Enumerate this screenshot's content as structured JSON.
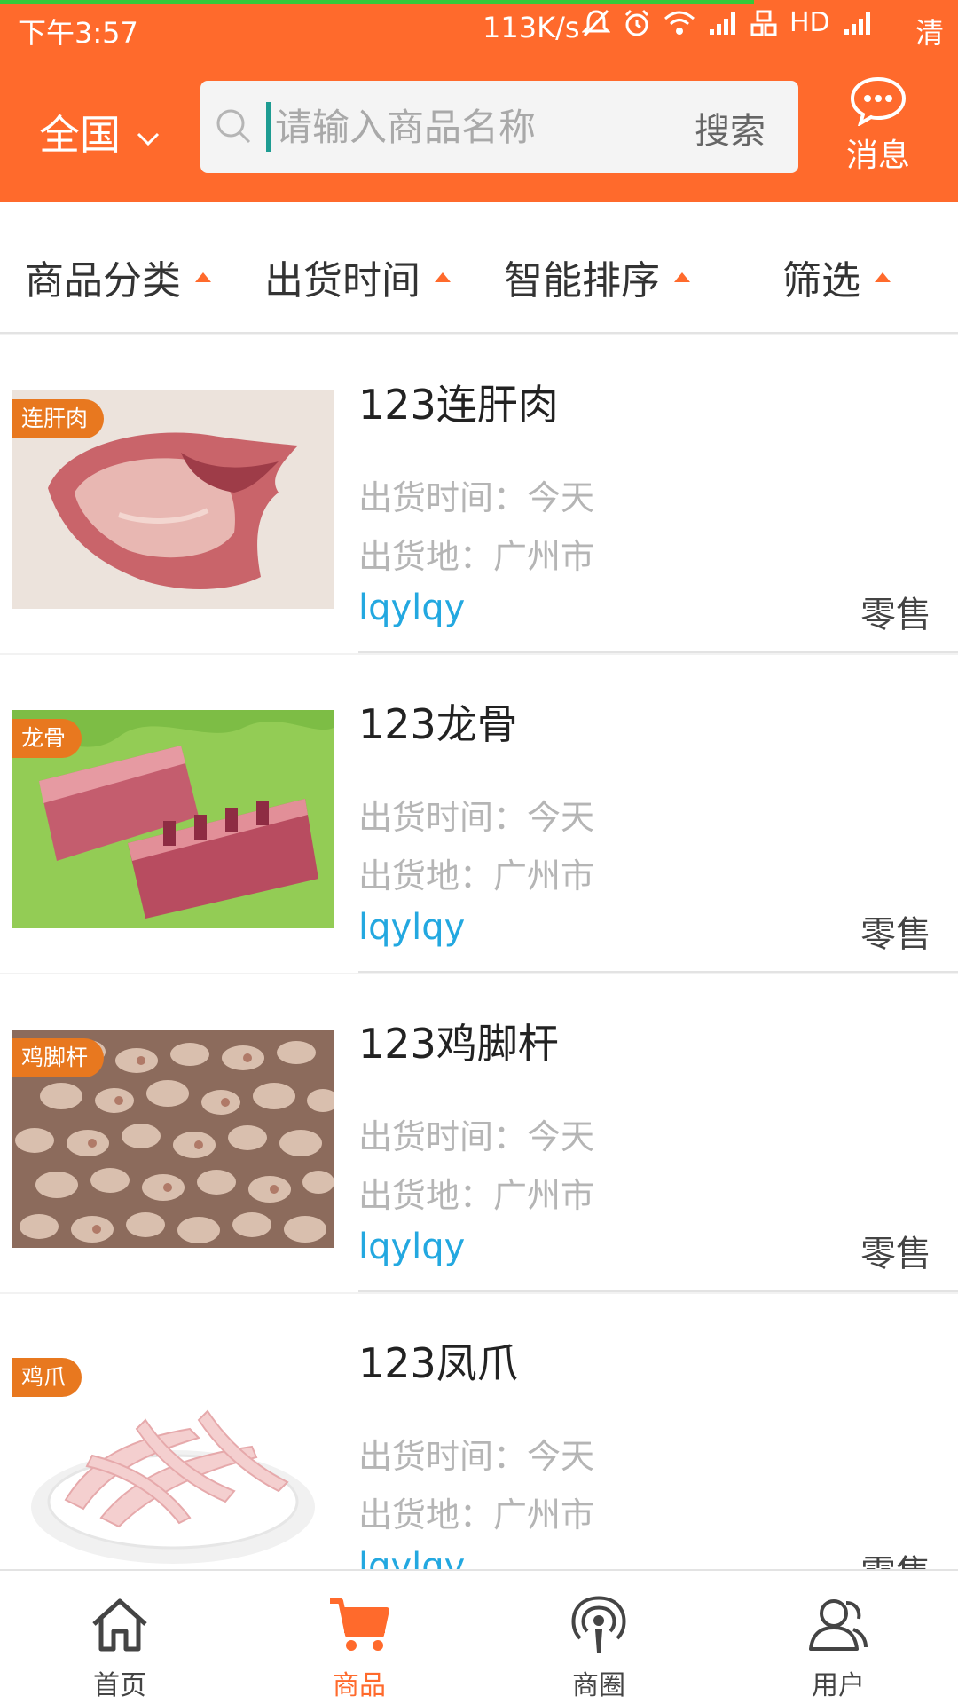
{
  "status_bar": {
    "time": "下午3:57",
    "network_speed": "113K/s",
    "hd_label": "HD",
    "right_label": "清"
  },
  "header": {
    "region_label": "全国",
    "search_placeholder": "请输入商品名称",
    "search_button": "搜索",
    "message_label": "消息",
    "accent_color": "#ff6a2c"
  },
  "filters": [
    {
      "label": "商品分类"
    },
    {
      "label": "出货时间"
    },
    {
      "label": "智能排序"
    },
    {
      "label": "筛选"
    }
  ],
  "products": [
    {
      "tag": "连肝肉",
      "name": "123连肝肉",
      "ship_time": "出货时间：今天",
      "ship_place": "出货地：广州市",
      "seller": "lqylqy",
      "type": "零售",
      "image": "meat-slab"
    },
    {
      "tag": "龙骨",
      "name": "123龙骨",
      "ship_time": "出货时间：今天",
      "ship_place": "出货地：广州市",
      "seller": "lqylqy",
      "type": "零售",
      "image": "ribs-on-lettuce"
    },
    {
      "tag": "鸡脚杆",
      "name": "123鸡脚杆",
      "ship_time": "出货时间：今天",
      "ship_place": "出货地：广州市",
      "seller": "lqylqy",
      "type": "零售",
      "image": "chicken-pieces"
    },
    {
      "tag": "鸡爪",
      "name": "123凤爪",
      "ship_time": "出货时间：今天",
      "ship_place": "出货地：广州市",
      "seller": "lqylqy",
      "type": "零售",
      "image": "chicken-feet-plate"
    }
  ],
  "tabs": [
    {
      "label": "首页",
      "icon": "home-icon",
      "active": false
    },
    {
      "label": "商品",
      "icon": "cart-icon",
      "active": true
    },
    {
      "label": "商圈",
      "icon": "broadcast-icon",
      "active": false
    },
    {
      "label": "用户",
      "icon": "user-icon",
      "active": false
    }
  ]
}
